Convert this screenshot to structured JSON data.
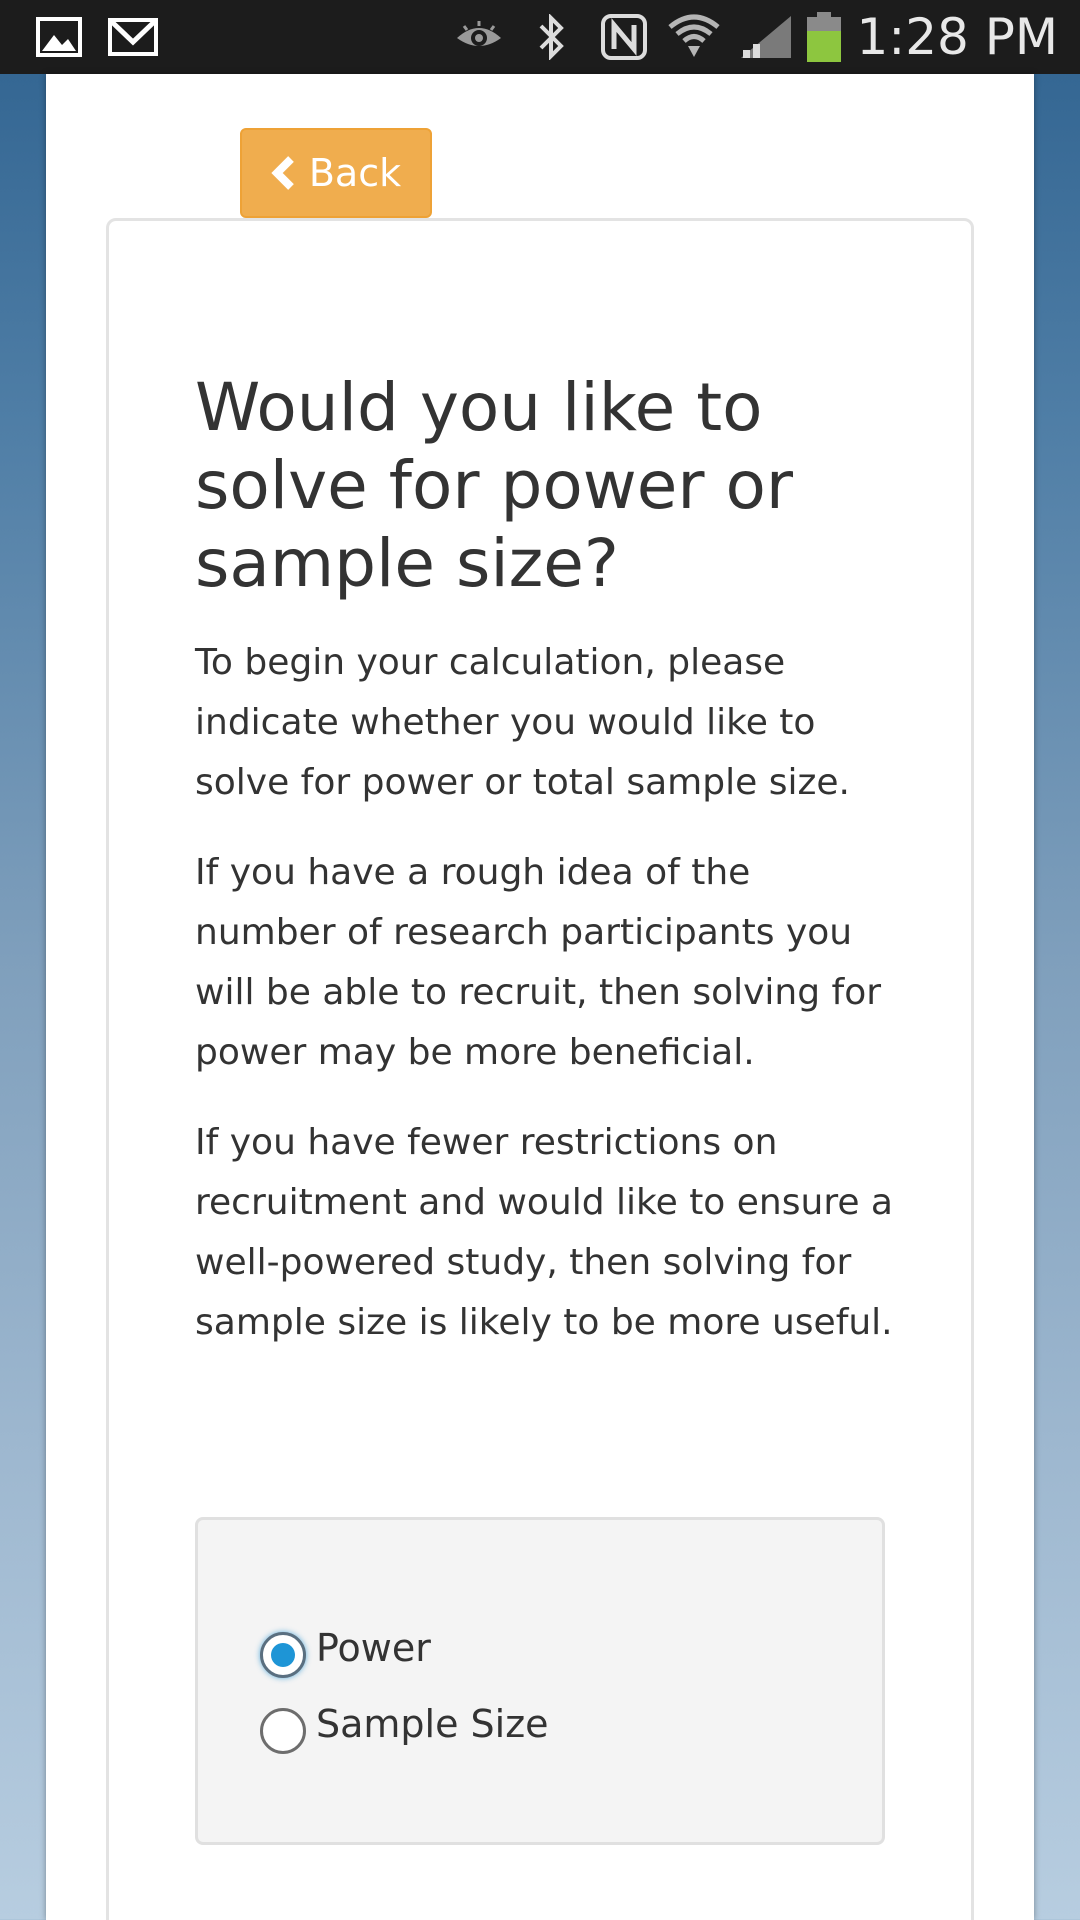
{
  "status_bar": {
    "time": "1:28 PM",
    "icons": [
      "gallery-icon",
      "gmail-icon",
      "eye-icon",
      "bluetooth-icon",
      "nfc-icon",
      "wifi-icon",
      "signal-icon",
      "battery-icon"
    ],
    "battery_color": "#8dc63f"
  },
  "toolbar": {
    "back_label": "Back"
  },
  "main": {
    "title": "Would you like to solve for power or sample size?",
    "paragraphs": [
      "To begin your calculation, please indicate whether you would like to solve for power or total sample size.",
      "If you have a rough idea of the number of research participants you will be able to recruit, then solving for power may be more beneficial.",
      "If you have fewer restrictions on recruitment and would like to ensure a well-powered study, then solving for sample size is likely to be more useful."
    ],
    "options": [
      {
        "label": "Power",
        "selected": true
      },
      {
        "label": "Sample Size",
        "selected": false
      }
    ]
  },
  "colors": {
    "accent_button": "#f0ad4e",
    "radio_selected": "#1e95d6",
    "background_top": "#2f628f",
    "background_bottom": "#b7cde0"
  }
}
